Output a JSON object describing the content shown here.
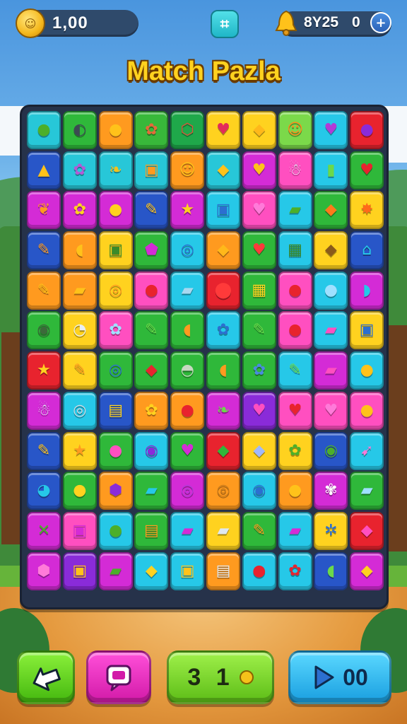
{
  "header": {
    "coins": "1,00",
    "score": "8Y25",
    "score_secondary": "0",
    "menu_icon": "grid-menu-icon",
    "add_icon": "plus-icon"
  },
  "title": "Match Pazla",
  "board": {
    "rows": [
      [
        {
          "c": "#27c7d8",
          "g": "●",
          "gc": "#4caf2a"
        },
        {
          "c": "#2fb83a",
          "g": "◐",
          "gc": "#3c4a52"
        },
        {
          "c": "#ff9a1f",
          "g": "●",
          "gc": "#ffc21a"
        },
        {
          "c": "#38b83a",
          "g": "✿",
          "gc": "#e36a3a"
        },
        {
          "c": "#1fa84a",
          "g": "⬡",
          "gc": "#e0503a"
        },
        {
          "c": "#ffd21f",
          "g": "♥",
          "gc": "#e32b5a"
        },
        {
          "c": "#ffd21f",
          "g": "◆",
          "gc": "#ffb81a"
        },
        {
          "c": "#7bd94a",
          "g": "☺",
          "gc": "#ff8a1a"
        },
        {
          "c": "#26c8e8",
          "g": "♥",
          "gc": "#b23ad6"
        },
        {
          "c": "#e8232e",
          "g": "●",
          "gc": "#8a2bd9"
        }
      ],
      [
        {
          "c": "#2856c8",
          "g": "▲",
          "gc": "#ffc21a"
        },
        {
          "c": "#27c7d8",
          "g": "✿",
          "gc": "#b35ad6"
        },
        {
          "c": "#27c7d8",
          "g": "❧",
          "gc": "#f5c21a"
        },
        {
          "c": "#27c7d8",
          "g": "▣",
          "gc": "#ff9a1f"
        },
        {
          "c": "#ff9a1f",
          "g": "☺",
          "gc": "#ffc21a"
        },
        {
          "c": "#27c7d8",
          "g": "◆",
          "gc": "#ffc21a"
        },
        {
          "c": "#d42bd6",
          "g": "♥",
          "gc": "#ffc21a"
        },
        {
          "c": "#ff4fc0",
          "g": "☃",
          "gc": "#dfe8f0"
        },
        {
          "c": "#26c8e8",
          "g": "▮",
          "gc": "#6bd94a"
        },
        {
          "c": "#2fb83a",
          "g": "♥",
          "gc": "#e8232e"
        }
      ],
      [
        {
          "c": "#d42bd6",
          "g": "❦",
          "gc": "#ff9a1f"
        },
        {
          "c": "#d42bd6",
          "g": "✿",
          "gc": "#ffd21f"
        },
        {
          "c": "#d42bd6",
          "g": "●",
          "gc": "#ffd21f"
        },
        {
          "c": "#2856c8",
          "g": "✎",
          "gc": "#ffc21a"
        },
        {
          "c": "#d42bd6",
          "g": "★",
          "gc": "#ffd21f"
        },
        {
          "c": "#26c8e8",
          "g": "▣",
          "gc": "#2c6fd0"
        },
        {
          "c": "#ff4fc0",
          "g": "♥",
          "gc": "#ff7ad9"
        },
        {
          "c": "#26c8e8",
          "g": "▰",
          "gc": "#4caf2a"
        },
        {
          "c": "#2fb83a",
          "g": "◆",
          "gc": "#ff7a1a"
        },
        {
          "c": "#ffd21f",
          "g": "✸",
          "gc": "#ff6a1a"
        }
      ],
      [
        {
          "c": "#2856c8",
          "g": "✎",
          "gc": "#ff9a1f"
        },
        {
          "c": "#ff9a1f",
          "g": "◖",
          "gc": "#ffc21a"
        },
        {
          "c": "#ffd21f",
          "g": "▣",
          "gc": "#3a8a2a"
        },
        {
          "c": "#2fb83a",
          "g": "⬟",
          "gc": "#d42bd6"
        },
        {
          "c": "#26c8e8",
          "g": "◎",
          "gc": "#2c6fd0"
        },
        {
          "c": "#ff9a1f",
          "g": "◆",
          "gc": "#ffb81a"
        },
        {
          "c": "#2fb83a",
          "g": "♥",
          "gc": "#ff3a3a"
        },
        {
          "c": "#26c8e8",
          "g": "▦",
          "gc": "#3a8a2a"
        },
        {
          "c": "#ffd21f",
          "g": "◆",
          "gc": "#8a5a1a"
        },
        {
          "c": "#2856c8",
          "g": "⌂",
          "gc": "#26c8e8"
        }
      ],
      [
        {
          "c": "#ff9a1f",
          "g": "✎",
          "gc": "#ffc21a"
        },
        {
          "c": "#ff9a1f",
          "g": "▰",
          "gc": "#ffc21a"
        },
        {
          "c": "#ffd21f",
          "g": "◎",
          "gc": "#ff9a1f"
        },
        {
          "c": "#ff4fc0",
          "g": "●",
          "gc": "#e8232e"
        },
        {
          "c": "#26c8e8",
          "g": "▰",
          "gc": "#a8d8f0"
        },
        {
          "c": "#e8232e",
          "g": "⬤",
          "gc": "#ff3a3a"
        },
        {
          "c": "#2fb83a",
          "g": "▦",
          "gc": "#ffd21f"
        },
        {
          "c": "#ff4fc0",
          "g": "●",
          "gc": "#e8232e"
        },
        {
          "c": "#26c8e8",
          "g": "●",
          "gc": "#9fe0ff"
        },
        {
          "c": "#d42bd6",
          "g": "◗",
          "gc": "#26c8e8"
        }
      ],
      [
        {
          "c": "#2fb83a",
          "g": "◉",
          "gc": "#3c6a3a"
        },
        {
          "c": "#ffd21f",
          "g": "◔",
          "gc": "#e8eef2"
        },
        {
          "c": "#ff4fc0",
          "g": "✿",
          "gc": "#9fe0ff"
        },
        {
          "c": "#2fb83a",
          "g": "✎",
          "gc": "#6bd94a"
        },
        {
          "c": "#2fb83a",
          "g": "◖",
          "gc": "#ff9a1f"
        },
        {
          "c": "#26c8e8",
          "g": "✿",
          "gc": "#2c6fd0"
        },
        {
          "c": "#2fb83a",
          "g": "✎",
          "gc": "#6bd94a"
        },
        {
          "c": "#ff4fc0",
          "g": "●",
          "gc": "#e8232e"
        },
        {
          "c": "#26c8e8",
          "g": "▰",
          "gc": "#ff4fc0"
        },
        {
          "c": "#ffd21f",
          "g": "▣",
          "gc": "#2c6fd0"
        }
      ],
      [
        {
          "c": "#e8232e",
          "g": "★",
          "gc": "#ffd21f"
        },
        {
          "c": "#ffd21f",
          "g": "✎",
          "gc": "#ff9a1f"
        },
        {
          "c": "#2fb83a",
          "g": "◎",
          "gc": "#2c6fd0"
        },
        {
          "c": "#2fb83a",
          "g": "◆",
          "gc": "#e8232e"
        },
        {
          "c": "#2fb83a",
          "g": "◓",
          "gc": "#c8d8c0"
        },
        {
          "c": "#2fb83a",
          "g": "◖",
          "gc": "#ff9a1f"
        },
        {
          "c": "#2fb83a",
          "g": "✿",
          "gc": "#4a8ae0"
        },
        {
          "c": "#26c8e8",
          "g": "✎",
          "gc": "#6bd94a"
        },
        {
          "c": "#d42bd6",
          "g": "▰",
          "gc": "#ff4fc0"
        },
        {
          "c": "#26c8e8",
          "g": "●",
          "gc": "#ffc21a"
        }
      ],
      [
        {
          "c": "#d42bd6",
          "g": "☃",
          "gc": "#dfe8f0"
        },
        {
          "c": "#26c8e8",
          "g": "◎",
          "gc": "#d0d8e0"
        },
        {
          "c": "#2856c8",
          "g": "▤",
          "gc": "#ffd21f"
        },
        {
          "c": "#ff9a1f",
          "g": "✿",
          "gc": "#ffd21f"
        },
        {
          "c": "#ff9a1f",
          "g": "●",
          "gc": "#e8232e"
        },
        {
          "c": "#d42bd6",
          "g": "❧",
          "gc": "#6bd94a"
        },
        {
          "c": "#8a2bd9",
          "g": "♥",
          "gc": "#ff4fc0"
        },
        {
          "c": "#ff4fc0",
          "g": "♥",
          "gc": "#e8232e"
        },
        {
          "c": "#ff4fc0",
          "g": "♥",
          "gc": "#ff7ad9"
        },
        {
          "c": "#ff4fc0",
          "g": "●",
          "gc": "#ffc21a"
        }
      ],
      [
        {
          "c": "#2856c8",
          "g": "✎",
          "gc": "#ffc21a"
        },
        {
          "c": "#ffd21f",
          "g": "★",
          "gc": "#ff9a1f"
        },
        {
          "c": "#2fb83a",
          "g": "●",
          "gc": "#ff4fc0"
        },
        {
          "c": "#26c8e8",
          "g": "◉",
          "gc": "#8a2bd9"
        },
        {
          "c": "#2fb83a",
          "g": "♥",
          "gc": "#d42bd6"
        },
        {
          "c": "#e8232e",
          "g": "◆",
          "gc": "#2fb83a"
        },
        {
          "c": "#ffd21f",
          "g": "◆",
          "gc": "#9fb8ff"
        },
        {
          "c": "#ffd21f",
          "g": "✿",
          "gc": "#4caf2a"
        },
        {
          "c": "#2856c8",
          "g": "◉",
          "gc": "#4caf2a"
        },
        {
          "c": "#26c8e8",
          "g": "➹",
          "gc": "#ff7ad9"
        }
      ],
      [
        {
          "c": "#2856c8",
          "g": "◕",
          "gc": "#26c8e8"
        },
        {
          "c": "#2fb83a",
          "g": "●",
          "gc": "#ffd21f"
        },
        {
          "c": "#ff9a1f",
          "g": "⬢",
          "gc": "#8a2bd9"
        },
        {
          "c": "#2fb83a",
          "g": "▰",
          "gc": "#26c8e8"
        },
        {
          "c": "#d42bd6",
          "g": "◎",
          "gc": "#b23ad6"
        },
        {
          "c": "#ff9a1f",
          "g": "◎",
          "gc": "#c97a1a"
        },
        {
          "c": "#26c8e8",
          "g": "◉",
          "gc": "#2c6fd0"
        },
        {
          "c": "#ff9a1f",
          "g": "●",
          "gc": "#ffc21a"
        },
        {
          "c": "#d42bd6",
          "g": "✾",
          "gc": "#ffffff"
        },
        {
          "c": "#2fb83a",
          "g": "▰",
          "gc": "#9fe0ff"
        }
      ],
      [
        {
          "c": "#d42bd6",
          "g": "✕",
          "gc": "#4caf2a"
        },
        {
          "c": "#ff4fc0",
          "g": "▣",
          "gc": "#d42bd6"
        },
        {
          "c": "#26c8e8",
          "g": "●",
          "gc": "#4caf2a"
        },
        {
          "c": "#2fb83a",
          "g": "▤",
          "gc": "#ff9a1f"
        },
        {
          "c": "#26c8e8",
          "g": "▰",
          "gc": "#d42bd6"
        },
        {
          "c": "#ffd21f",
          "g": "▰",
          "gc": "#dfe8f0"
        },
        {
          "c": "#2fb83a",
          "g": "✎",
          "gc": "#ff9a1f"
        },
        {
          "c": "#26c8e8",
          "g": "▰",
          "gc": "#d42bd6"
        },
        {
          "c": "#ffd21f",
          "g": "✲",
          "gc": "#2c6fd0"
        },
        {
          "c": "#e8232e",
          "g": "◆",
          "gc": "#ff4fc0"
        }
      ],
      [
        {
          "c": "#d42bd6",
          "g": "⬢",
          "gc": "#ff7ad9"
        },
        {
          "c": "#8a2bd9",
          "g": "▣",
          "gc": "#ffc21a"
        },
        {
          "c": "#d42bd6",
          "g": "▰",
          "gc": "#4caf2a"
        },
        {
          "c": "#26c8e8",
          "g": "◆",
          "gc": "#ffd21f"
        },
        {
          "c": "#26c8e8",
          "g": "▣",
          "gc": "#ffc21a"
        },
        {
          "c": "#ff9a1f",
          "g": "▤",
          "gc": "#dfe8f0"
        },
        {
          "c": "#26c8e8",
          "g": "●",
          "gc": "#e8232e"
        },
        {
          "c": "#26c8e8",
          "g": "✿",
          "gc": "#e8232e"
        },
        {
          "c": "#2856c8",
          "g": "◖",
          "gc": "#6bd94a"
        },
        {
          "c": "#d42bd6",
          "g": "◆",
          "gc": "#ffd21f"
        }
      ]
    ]
  },
  "controls": {
    "back_icon": "back-arrow-icon",
    "hint_icon": "speech-bubble-icon",
    "moves": "3 1",
    "play_icon": "play-icon",
    "play_value": "00"
  }
}
